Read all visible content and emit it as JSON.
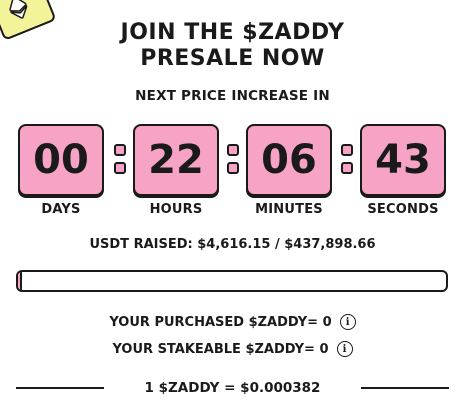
{
  "header": {
    "title_line1": "JOIN THE $ZADDY",
    "title_line2": "PRESALE NOW",
    "subtitle": "NEXT PRICE INCREASE IN"
  },
  "countdown": [
    {
      "value": "00",
      "label": "DAYS"
    },
    {
      "value": "22",
      "label": "HOURS"
    },
    {
      "value": "06",
      "label": "MINUTES"
    },
    {
      "value": "43",
      "label": "SECONDS"
    }
  ],
  "raised": {
    "text": "USDT RAISED: $4,616.15 / $437,898.66",
    "progress_fraction": 0.0105
  },
  "wallet": {
    "purchased": "YOUR PURCHASED $ZADDY= 0",
    "stakeable": "YOUR STAKEABLE $ZADDY= 0"
  },
  "price": {
    "text": "1 $ZADDY = $0.000382"
  },
  "icons": {
    "corner": "ethereum-icon",
    "info": "info-icon"
  },
  "colors": {
    "accent_pink": "#f7a3c6",
    "corner_yellow": "#f3f39a",
    "ink": "#1a1a1a"
  }
}
